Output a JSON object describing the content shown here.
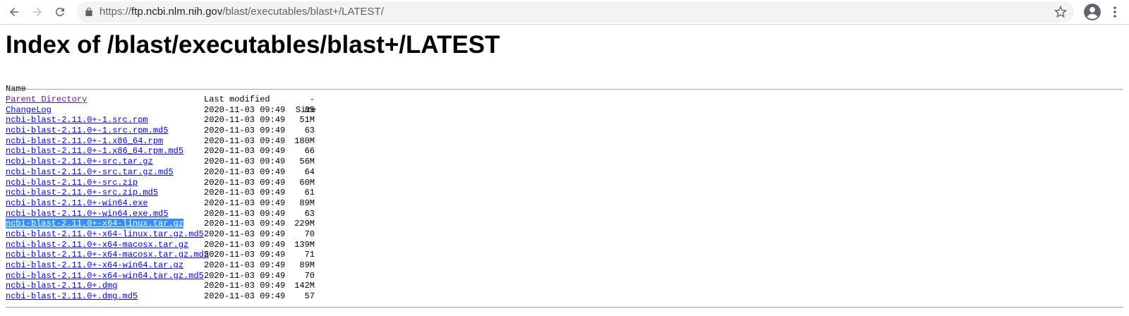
{
  "browser": {
    "url": {
      "scheme": "https://",
      "host": "ftp.ncbi.nlm.nih.gov",
      "path": "/blast/executables/blast+/LATEST/"
    }
  },
  "page": {
    "title": "Index of /blast/executables/blast+/LATEST"
  },
  "listing": {
    "headers": {
      "name": "Name",
      "last_modified": "Last modified",
      "size": "Size"
    },
    "rows": [
      {
        "name": "Parent Directory",
        "modified": "",
        "size": "-"
      },
      {
        "name": "ChangeLog",
        "modified": "2020-11-03 09:49",
        "size": "85"
      },
      {
        "name": "ncbi-blast-2.11.0+-1.src.rpm",
        "modified": "2020-11-03 09:49",
        "size": "51M"
      },
      {
        "name": "ncbi-blast-2.11.0+-1.src.rpm.md5",
        "modified": "2020-11-03 09:49",
        "size": "63"
      },
      {
        "name": "ncbi-blast-2.11.0+-1.x86_64.rpm",
        "modified": "2020-11-03 09:49",
        "size": "180M"
      },
      {
        "name": "ncbi-blast-2.11.0+-1.x86_64.rpm.md5",
        "modified": "2020-11-03 09:49",
        "size": "66"
      },
      {
        "name": "ncbi-blast-2.11.0+-src.tar.gz",
        "modified": "2020-11-03 09:49",
        "size": "56M"
      },
      {
        "name": "ncbi-blast-2.11.0+-src.tar.gz.md5",
        "modified": "2020-11-03 09:49",
        "size": "64"
      },
      {
        "name": "ncbi-blast-2.11.0+-src.zip",
        "modified": "2020-11-03 09:49",
        "size": "60M"
      },
      {
        "name": "ncbi-blast-2.11.0+-src.zip.md5",
        "modified": "2020-11-03 09:49",
        "size": "61"
      },
      {
        "name": "ncbi-blast-2.11.0+-win64.exe",
        "modified": "2020-11-03 09:49",
        "size": "89M"
      },
      {
        "name": "ncbi-blast-2.11.0+-win64.exe.md5",
        "modified": "2020-11-03 09:49",
        "size": "63"
      },
      {
        "name": "ncbi-blast-2.11.0+-x64-linux.tar.gz",
        "modified": "2020-11-03 09:49",
        "size": "229M"
      },
      {
        "name": "ncbi-blast-2.11.0+-x64-linux.tar.gz.md5",
        "modified": "2020-11-03 09:49",
        "size": "70"
      },
      {
        "name": "ncbi-blast-2.11.0+-x64-macosx.tar.gz",
        "modified": "2020-11-03 09:49",
        "size": "139M"
      },
      {
        "name": "ncbi-blast-2.11.0+-x64-macosx.tar.gz.md5",
        "modified": "2020-11-03 09:49",
        "size": "71"
      },
      {
        "name": "ncbi-blast-2.11.0+-x64-win64.tar.gz",
        "modified": "2020-11-03 09:49",
        "size": "89M"
      },
      {
        "name": "ncbi-blast-2.11.0+-x64-win64.tar.gz.md5",
        "modified": "2020-11-03 09:49",
        "size": "70"
      },
      {
        "name": "ncbi-blast-2.11.0+.dmg",
        "modified": "2020-11-03 09:49",
        "size": "142M"
      },
      {
        "name": "ncbi-blast-2.11.0+.dmg.md5",
        "modified": "2020-11-03 09:49",
        "size": "57"
      }
    ]
  },
  "colors": {
    "link": "#0000ee",
    "visited_link": "#551a8b",
    "selection": "#3390ff"
  },
  "icons": {
    "back": "back-arrow-icon",
    "forward": "forward-arrow-icon",
    "reload": "reload-icon",
    "lock": "lock-icon",
    "star": "star-icon",
    "account": "account-icon",
    "menu": "more-vertical-icon"
  }
}
